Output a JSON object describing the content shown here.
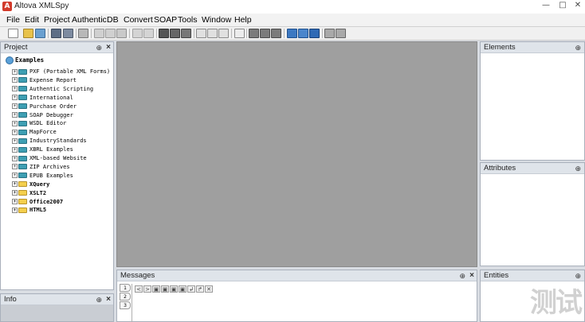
{
  "window": {
    "title": "Altova XMLSpy",
    "icon_letter": "A",
    "controls": [
      "minimize",
      "maximize",
      "close"
    ]
  },
  "menu": [
    {
      "label": "File"
    },
    {
      "label": "Edit"
    },
    {
      "label": "Project"
    },
    {
      "label": "Authentic"
    },
    {
      "label": "DB"
    },
    {
      "label": "Convert"
    },
    {
      "label": "SOAP"
    },
    {
      "label": "Tools"
    },
    {
      "label": "Window"
    },
    {
      "label": "Help"
    }
  ],
  "toolbar": {
    "icons": [
      "new-file-icon",
      "open-folder-icon",
      "open-url-icon",
      "save-icon",
      "save-all-icon",
      "print-icon",
      "cut-icon",
      "copy-icon",
      "paste-icon",
      "undo-icon",
      "redo-icon",
      "find-icon",
      "find-next-icon",
      "replace-icon",
      "validate-icon",
      "well-formed-icon",
      "xslt-icon",
      "xquery-icon",
      "check-icon",
      "arrow-down-icon",
      "arrow-up-icon",
      "arrow-right-icon",
      "text-view-icon",
      "grid-view-icon",
      "schema-view-icon",
      "browser-icon",
      "spell-icon"
    ]
  },
  "project": {
    "header": "Project",
    "root": "Examples",
    "items": [
      {
        "label": "PXF (Portable XML Forms)",
        "color": "teal",
        "bold": false
      },
      {
        "label": "Expense Report",
        "color": "teal",
        "bold": false
      },
      {
        "label": "Authentic Scripting",
        "color": "teal",
        "bold": false
      },
      {
        "label": "International",
        "color": "teal",
        "bold": false
      },
      {
        "label": "Purchase Order",
        "color": "teal",
        "bold": false
      },
      {
        "label": "SOAP Debugger",
        "color": "teal",
        "bold": false
      },
      {
        "label": "WSDL Editor",
        "color": "teal",
        "bold": false
      },
      {
        "label": "MapForce",
        "color": "teal",
        "bold": false
      },
      {
        "label": "IndustryStandards",
        "color": "teal",
        "bold": false
      },
      {
        "label": "XBRL Examples",
        "color": "teal",
        "bold": false
      },
      {
        "label": "XML-based Website",
        "color": "teal",
        "bold": false
      },
      {
        "label": "ZIP Archives",
        "color": "teal",
        "bold": false
      },
      {
        "label": "EPUB Examples",
        "color": "teal",
        "bold": false
      },
      {
        "label": "XQuery",
        "color": "yellow",
        "bold": true
      },
      {
        "label": "XSLT2",
        "color": "yellow",
        "bold": true
      },
      {
        "label": "Office2007",
        "color": "yellow",
        "bold": true
      },
      {
        "label": "HTML5",
        "color": "yellow",
        "bold": true
      }
    ]
  },
  "info": {
    "header": "Info"
  },
  "messages": {
    "header": "Messages",
    "buttons": [
      "<",
      ">",
      "▣",
      "▣",
      "▣",
      "▣",
      "↲",
      "↱",
      "✕"
    ]
  },
  "panels": {
    "elements": "Elements",
    "attributes": "Attributes",
    "entities": "Entities"
  },
  "panel_controls": {
    "pin": "⊕",
    "close": "×"
  },
  "watermark": "测试"
}
